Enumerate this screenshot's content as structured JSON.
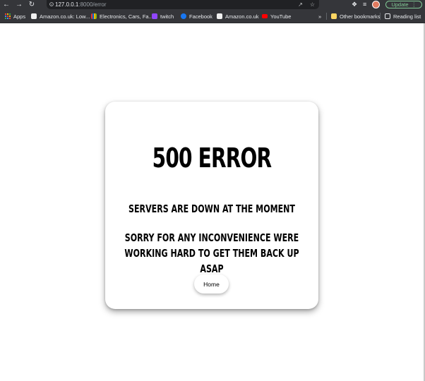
{
  "browser": {
    "url_host": "127.0.0.1",
    "url_path": ":8000/error",
    "update_label": "Update",
    "bookmarks": [
      {
        "label": "Apps",
        "icon": "apps-grid-icon"
      },
      {
        "label": "Amazon.co.uk: Low...",
        "icon": "amazon-icon"
      },
      {
        "label": "Electronics, Cars, Fa...",
        "icon": "ebay-icon"
      },
      {
        "label": "twitch",
        "icon": "twitch-icon"
      },
      {
        "label": "Facebook",
        "icon": "facebook-icon"
      },
      {
        "label": "Amazon.co.uk",
        "icon": "amazon-icon"
      },
      {
        "label": "YouTube",
        "icon": "youtube-icon"
      }
    ],
    "overflow_label": "»",
    "other_bookmarks_label": "Other bookmarks",
    "reading_list_label": "Reading list"
  },
  "page": {
    "title": "500 ERROR",
    "message_line1": "SERVERS ARE DOWN AT THE MOMENT",
    "message_line2": "SORRY FOR ANY INCONVENIENCE WERE",
    "message_line3": "WORKING HARD TO GET THEM BACK UP ASAP",
    "home_button_label": "Home"
  }
}
